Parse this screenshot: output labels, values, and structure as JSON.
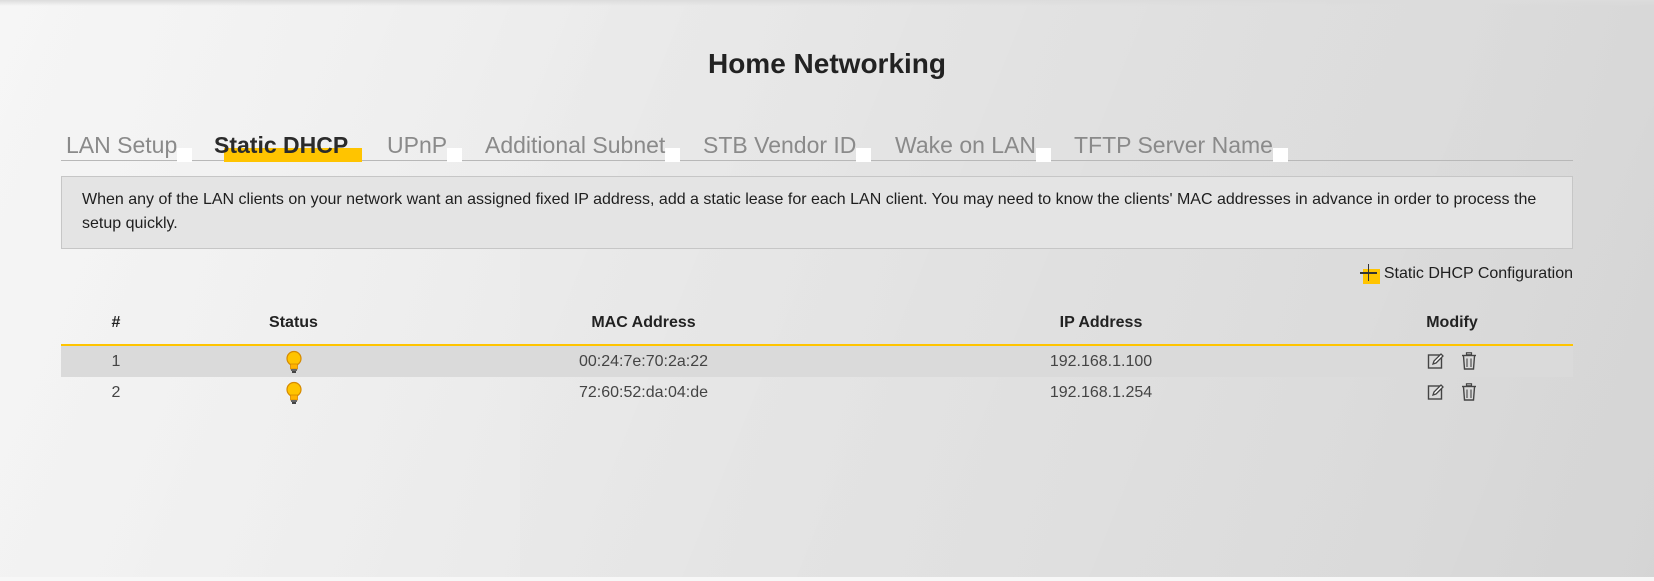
{
  "page": {
    "title": "Home Networking"
  },
  "tabs": [
    {
      "label": "LAN Setup",
      "active": false
    },
    {
      "label": "Static DHCP",
      "active": true
    },
    {
      "label": "UPnP",
      "active": false
    },
    {
      "label": "Additional Subnet",
      "active": false
    },
    {
      "label": "STB Vendor ID",
      "active": false
    },
    {
      "label": "Wake on LAN",
      "active": false
    },
    {
      "label": "TFTP Server Name",
      "active": false
    }
  ],
  "info": {
    "text": "When any of the LAN clients on your network want an assigned fixed IP address, add a static lease for each LAN client. You may need to know the clients' MAC addresses in advance in order to process the setup quickly."
  },
  "actions": {
    "add_label": "Static DHCP Configuration",
    "add_icon": "plus-icon"
  },
  "table": {
    "headers": [
      "#",
      "Status",
      "MAC Address",
      "IP Address",
      "Modify"
    ],
    "rows": [
      {
        "num": "1",
        "status": "bulb-on-icon",
        "mac": "00:24:7e:70:2a:22",
        "ip": "192.168.1.100"
      },
      {
        "num": "2",
        "status": "bulb-on-icon",
        "mac": "72:60:52:da:04:de",
        "ip": "192.168.1.254"
      }
    ],
    "modify_icons": [
      "edit-icon",
      "trash-icon"
    ]
  },
  "colors": {
    "accent": "#ffc400",
    "text": "#222222",
    "muted_tab": "#8a8a8a"
  }
}
